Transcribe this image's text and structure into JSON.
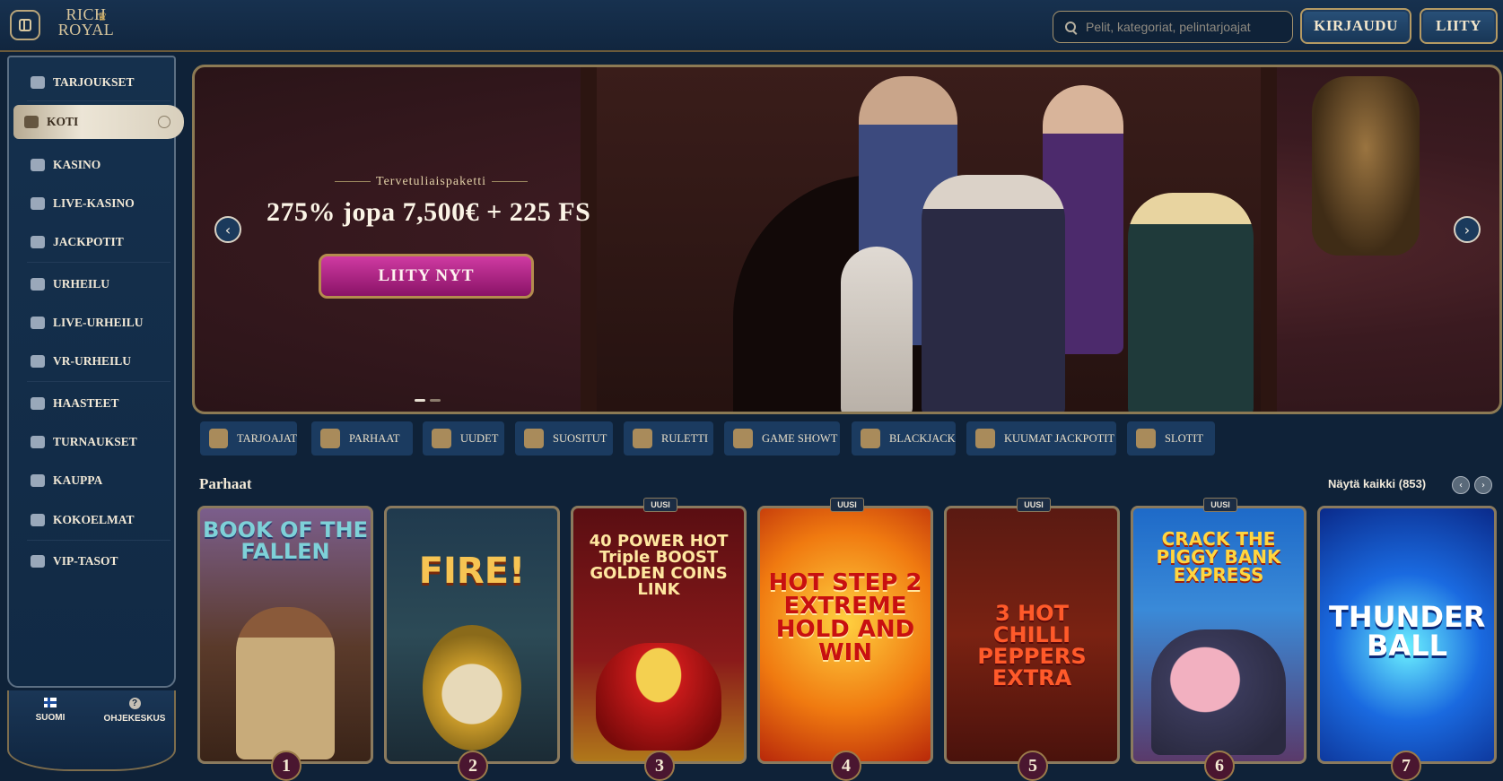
{
  "header": {
    "logo_line1": "RICH",
    "logo_line2": "ROYAL",
    "search_placeholder": "Pelit, kategoriat, pelintarjoajat",
    "login_label": "KIRJAUDU",
    "join_label": "LIITY"
  },
  "sidebar": {
    "items": [
      {
        "label": "TARJOUKSET",
        "icon": "gift-icon"
      },
      {
        "label": "KOTI",
        "icon": "home-icon",
        "active": true
      },
      {
        "label": "KASINO",
        "icon": "slot-machine-icon"
      },
      {
        "label": "LIVE-KASINO",
        "icon": "live-casino-icon"
      },
      {
        "label": "JACKPOTIT",
        "icon": "clover-icon"
      },
      {
        "label": "URHEILU",
        "icon": "ball-icon"
      },
      {
        "label": "LIVE-URHEILU",
        "icon": "live-sports-icon"
      },
      {
        "label": "VR-URHEILU",
        "icon": "vr-icon"
      },
      {
        "label": "HAASTEET",
        "icon": "challenge-icon"
      },
      {
        "label": "TURNAUKSET",
        "icon": "trophy-icon"
      },
      {
        "label": "KAUPPA",
        "icon": "shop-icon"
      },
      {
        "label": "KOKOELMAT",
        "icon": "collection-icon"
      },
      {
        "label": "VIP-TASOT",
        "icon": "diamond-icon"
      }
    ],
    "language_label": "SUOMI",
    "help_label": "OHJEKESKUS"
  },
  "hero": {
    "eyebrow": "Tervetuliaispaketti",
    "headline": "275% jopa 7,500€ + 225 FS",
    "cta_label": "LIITY NYT",
    "prev_arrow": "‹",
    "next_arrow": "›"
  },
  "categories": [
    "TARJOAJAT",
    "PARHAAT",
    "UUDET",
    "SUOSITUT",
    "RULETTI",
    "GAME SHOWT",
    "BLACKJACK",
    "KUUMAT JACKPOTIT",
    "SLOTIT"
  ],
  "section": {
    "title": "Parhaat",
    "view_all": "Näytä kaikki (853)",
    "new_badge": "UUSI"
  },
  "games": [
    {
      "rank": "1",
      "title": "BOOK OF THE FALLEN",
      "new": false
    },
    {
      "rank": "2",
      "title": "FIRE!",
      "new": false
    },
    {
      "rank": "3",
      "title": "40 POWER HOT Triple BOOST GOLDEN COINS LINK",
      "new": true
    },
    {
      "rank": "4",
      "title": "HOT STEP 2 EXTREME HOLD AND WIN",
      "new": true
    },
    {
      "rank": "5",
      "title": "3 HOT CHILLI PEPPERS EXTRA",
      "new": true
    },
    {
      "rank": "6",
      "title": "CRACK THE PIGGY BANK EXPRESS",
      "new": true
    },
    {
      "rank": "7",
      "title": "THUNDER BALL",
      "new": false
    }
  ],
  "colors": {
    "background": "#0f2238",
    "gold_border": "#8a7a5e",
    "cta_magenta": "#b1268a"
  }
}
